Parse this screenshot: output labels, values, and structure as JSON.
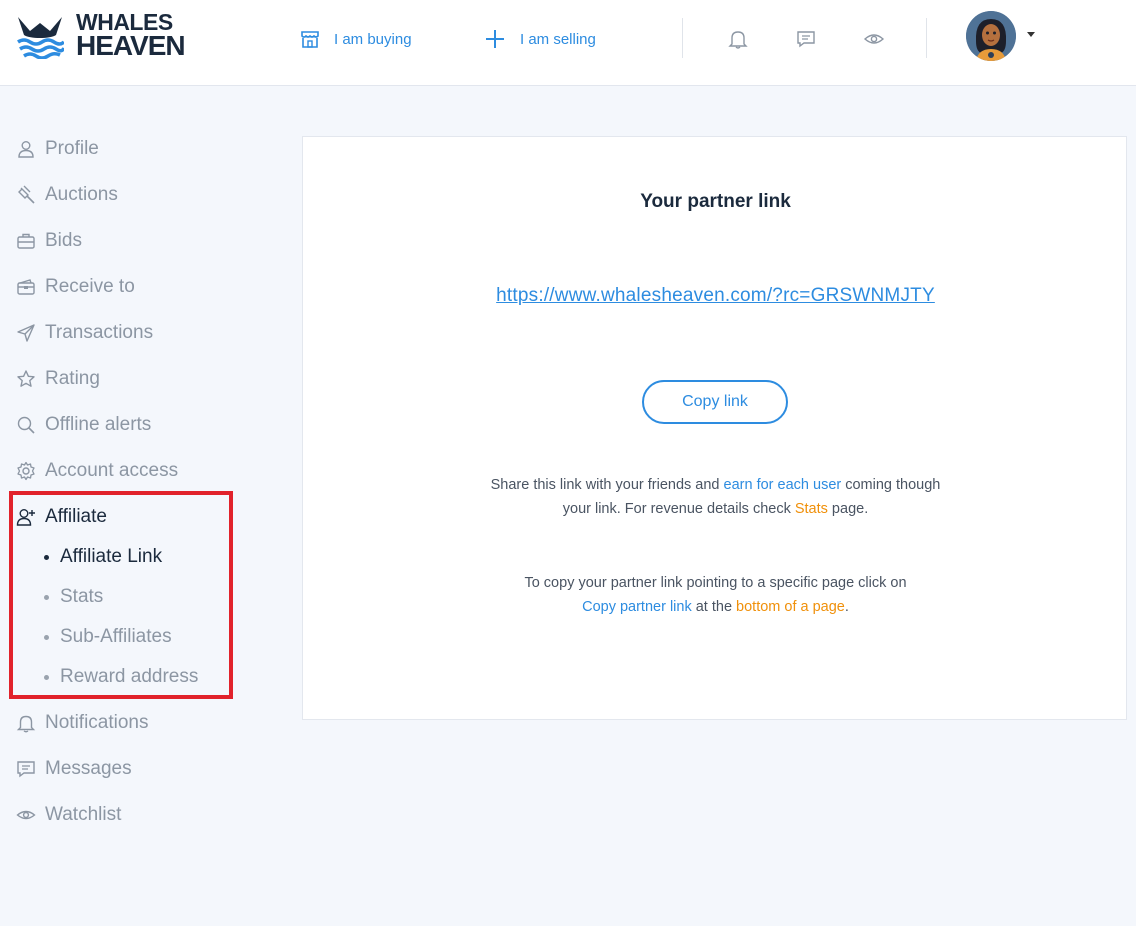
{
  "header": {
    "logo_line1": "WHALES",
    "logo_line2": "HEAVEN",
    "buy_label": "I am buying",
    "sell_label": "I am selling"
  },
  "sidebar": {
    "items": [
      {
        "label": "Profile",
        "icon": "user-icon"
      },
      {
        "label": "Auctions",
        "icon": "gavel-icon"
      },
      {
        "label": "Bids",
        "icon": "briefcase-icon"
      },
      {
        "label": "Receive to",
        "icon": "wallet-icon"
      },
      {
        "label": "Transactions",
        "icon": "paper-plane-icon"
      },
      {
        "label": "Rating",
        "icon": "star-icon"
      },
      {
        "label": "Offline alerts",
        "icon": "search-icon"
      },
      {
        "label": "Account access",
        "icon": "gear-icon"
      },
      {
        "label": "Affiliate",
        "icon": "user-plus-icon"
      },
      {
        "label": "Notifications",
        "icon": "bell-icon"
      },
      {
        "label": "Messages",
        "icon": "chat-icon"
      },
      {
        "label": "Watchlist",
        "icon": "eye-icon"
      }
    ],
    "affiliate_sub": [
      {
        "label": "Affiliate Link"
      },
      {
        "label": "Stats"
      },
      {
        "label": "Sub-Affiliates"
      },
      {
        "label": "Reward address"
      }
    ]
  },
  "main": {
    "title": "Your partner link",
    "link": "https://www.whalesheaven.com/?rc=GRSWNMJTY",
    "copy_button": "Copy link",
    "info1": {
      "part1": "Share this link with your friends and ",
      "link1": "earn for each user",
      "part2": " coming though",
      "part3": "your link. For revenue details check ",
      "link2": "Stats",
      "part4": " page."
    },
    "info2": {
      "part1": "To copy your partner link pointing to a specific page click on",
      "link1": "Copy partner link",
      "part2": " at the ",
      "link2": "bottom of a page",
      "part3": "."
    }
  },
  "colors": {
    "accent": "#2d8ce0",
    "orange": "#f0900a",
    "highlight": "#e1222b"
  }
}
